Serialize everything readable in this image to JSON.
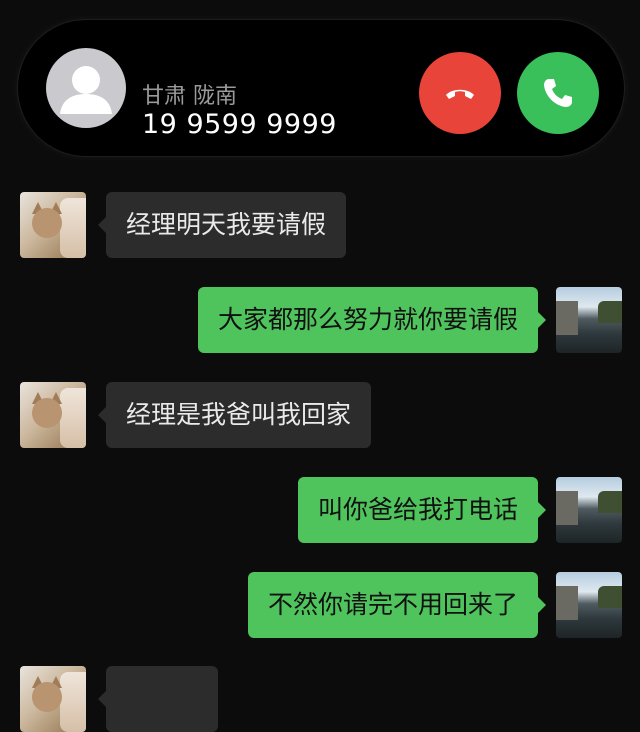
{
  "incoming_call": {
    "location": "甘肃 陇南",
    "phone_number": "19 9599 9999",
    "decline_icon": "phone-hangup-icon",
    "accept_icon": "phone-icon",
    "colors": {
      "decline": "#e9443a",
      "accept": "#39c05a"
    }
  },
  "chat": {
    "messages": [
      {
        "sender": "other",
        "avatar": "cat-avatar",
        "text": "经理明天我要请假"
      },
      {
        "sender": "self",
        "avatar": "river-avatar",
        "text": "大家都那么努力就你要请假"
      },
      {
        "sender": "other",
        "avatar": "cat-avatar",
        "text": "经理是我爸叫我回家"
      },
      {
        "sender": "self",
        "avatar": "river-avatar",
        "text": "叫你爸给我打电话"
      },
      {
        "sender": "self",
        "avatar": "river-avatar",
        "text": "不然你请完不用回来了"
      }
    ],
    "colors": {
      "incoming_bubble": "#2c2c2c",
      "outgoing_bubble": "#4fc45d"
    }
  }
}
